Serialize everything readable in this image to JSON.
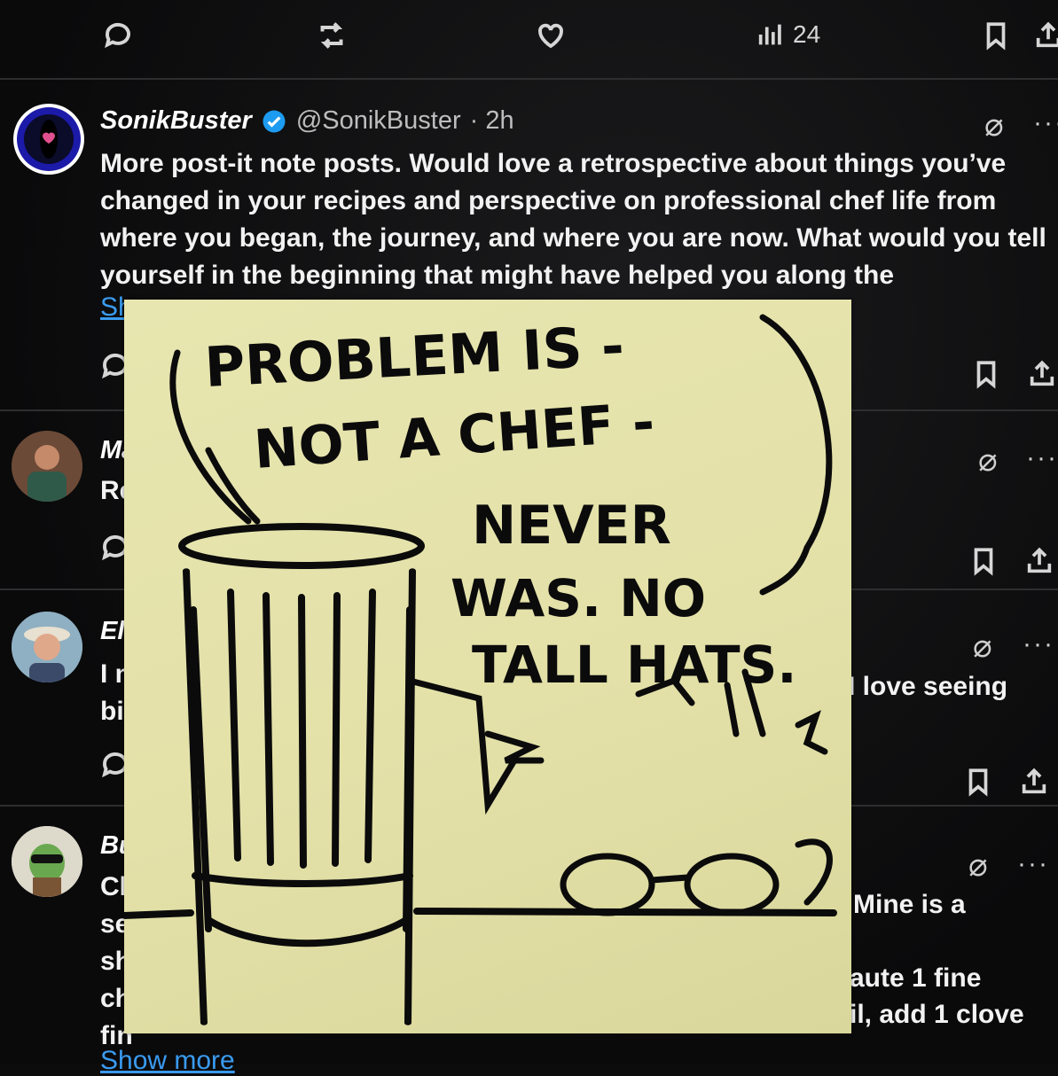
{
  "top_actions": {
    "views": "24"
  },
  "main_post": {
    "display_name": "SonikBuster",
    "handle": "@SonikBuster",
    "time": "· 2h",
    "text_lines": [
      "More post-it note posts. Would love a retrospective about things you’ve",
      "changed in your recipes and perspective on professional chef life from",
      "where you began, the journey, and where you are now. What would you tell",
      "yourself in the beginning that might have helped you along the"
    ],
    "show_more": "Show more"
  },
  "reply1": {
    "name_partial": "Ma",
    "text_partial": "Re"
  },
  "reply2": {
    "name_partial": "Eli",
    "line1_partial": "I m",
    "line2_partial": "bit",
    "right_fragment": "I love seeing"
  },
  "reply3": {
    "name_partial": "Bu",
    "left_fragments": [
      "Cl",
      "se",
      "sh",
      "ch",
      "fin"
    ],
    "right_fragments": [
      "Mine is a",
      "aute 1 fine",
      "il, add 1 clove"
    ],
    "show_more": "Show more"
  },
  "postit": {
    "lines": [
      "PROBLEM IS -",
      "NOT A CHEF -",
      "NEVER",
      "WAS. NO",
      "TALL HATS."
    ]
  },
  "colors": {
    "background": "#0c0c0d",
    "link": "#3a9bf0",
    "verified": "#1d9bf0",
    "postit": "#e6e4ad",
    "ink": "#0b0b0b"
  }
}
